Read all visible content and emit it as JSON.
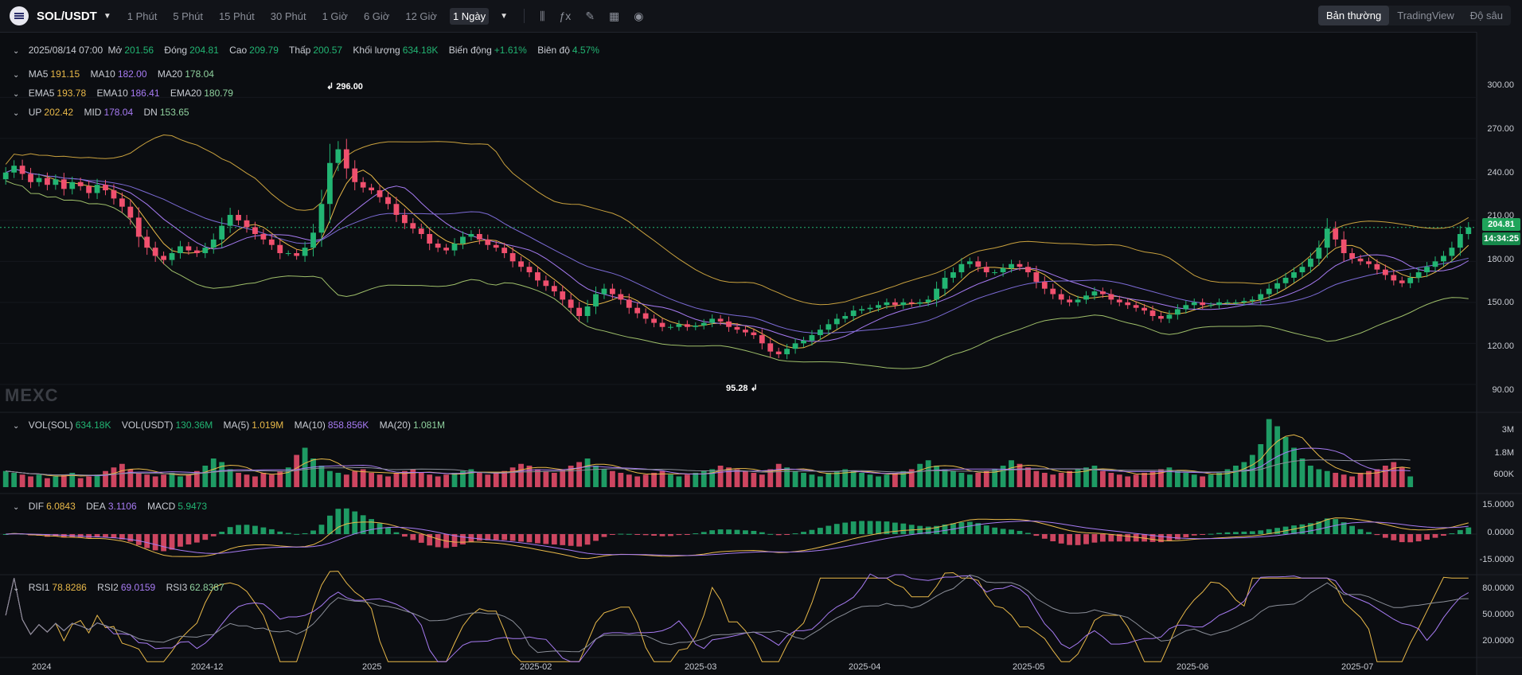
{
  "topbar": {
    "symbol": "SOL/USDT",
    "timeframes": [
      "1 Phút",
      "5 Phút",
      "15 Phút",
      "30 Phút",
      "1 Giờ",
      "6 Giờ",
      "12 Giờ",
      "1 Ngày"
    ],
    "active_timeframe": "1 Ngày",
    "views": [
      "Bản thường",
      "TradingView",
      "Độ sâu"
    ],
    "active_view": "Bản thường",
    "tools": [
      "candles-icon",
      "indicator-icon",
      "draw-icon",
      "layout-icon",
      "camera-icon"
    ]
  },
  "ohlc": {
    "date": "2025/08/14 07:00",
    "open_label": "Mở",
    "open": "201.56",
    "close_label": "Đóng",
    "close": "204.81",
    "high_label": "Cao",
    "high": "209.79",
    "low_label": "Thấp",
    "low": "200.57",
    "vol_label": "Khối lượng",
    "vol": "634.18K",
    "change_label": "Biến động",
    "change": "+1.61%",
    "amp_label": "Biên độ",
    "amp": "4.57%"
  },
  "ma": {
    "ma5_label": "MA5",
    "ma5": "191.15",
    "ma10_label": "MA10",
    "ma10": "182.00",
    "ma20_label": "MA20",
    "ma20": "178.04"
  },
  "ema": {
    "ema5_label": "EMA5",
    "ema5": "193.78",
    "ema10_label": "EMA10",
    "ema10": "186.41",
    "ema20_label": "EMA20",
    "ema20": "180.79"
  },
  "boll": {
    "up_label": "UP",
    "up": "202.42",
    "mid_label": "MID",
    "mid": "178.04",
    "dn_label": "DN",
    "dn": "153.65"
  },
  "volume": {
    "sol_label": "VOL(SOL)",
    "sol": "634.18K",
    "usdt_label": "VOL(USDT)",
    "usdt": "130.36M",
    "ma5_label": "MA(5)",
    "ma5": "1.019M",
    "ma10_label": "MA(10)",
    "ma10": "858.856K",
    "ma20_label": "MA(20)",
    "ma20": "1.081M"
  },
  "macd": {
    "dif_label": "DIF",
    "dif": "6.0843",
    "dea_label": "DEA",
    "dea": "3.1106",
    "macd_label": "MACD",
    "macd": "5.9473"
  },
  "rsi": {
    "rsi1_label": "RSI1",
    "rsi1": "78.8286",
    "rsi2_label": "RSI2",
    "rsi2": "69.0159",
    "rsi3_label": "RSI3",
    "rsi3": "62.8387"
  },
  "watermark": "MEXC",
  "colors": {
    "up": "#22b573",
    "down": "#f0506e",
    "ma5": "#e9b949",
    "ma10": "#a77bf3",
    "ma20": "#8fd19e",
    "background": "#0b0d11"
  },
  "chart_data": {
    "type": "candlestick",
    "last_price": "204.81",
    "countdown": "14:34:25",
    "max_label": "296.00",
    "min_label": "95.28",
    "price_axis": [
      "300.00",
      "270.00",
      "240.00",
      "210.00",
      "180.00",
      "150.00",
      "120.00",
      "90.00"
    ],
    "volume_axis": [
      "3M",
      "1.8M",
      "600K"
    ],
    "macd_axis": [
      "15.0000",
      "0.0000",
      "-15.0000"
    ],
    "rsi_axis": [
      "80.0000",
      "50.0000",
      "20.0000"
    ],
    "x_labels": [
      "2024",
      "2024-12",
      "2025",
      "2025-02",
      "2025-03",
      "2025-04",
      "2025-05",
      "2025-06",
      "2025-07"
    ],
    "price_range": [
      80,
      320
    ],
    "closes": [
      245,
      250,
      244,
      238,
      241,
      236,
      240,
      233,
      238,
      235,
      230,
      236,
      232,
      226,
      220,
      212,
      198,
      190,
      184,
      181,
      186,
      191,
      188,
      186,
      190,
      196,
      206,
      214,
      210,
      205,
      200,
      196,
      192,
      186,
      186,
      184,
      190,
      201,
      222,
      252,
      262,
      248,
      238,
      234,
      232,
      227,
      222,
      214,
      208,
      204,
      200,
      193,
      190,
      188,
      193,
      198,
      200,
      196,
      192,
      190,
      186,
      180,
      176,
      172,
      166,
      162,
      158,
      152,
      146,
      140,
      147,
      156,
      160,
      156,
      152,
      146,
      142,
      138,
      135,
      132,
      132,
      134,
      132,
      133,
      135,
      138,
      136,
      132,
      130,
      128,
      126,
      120,
      114,
      112,
      116,
      120,
      122,
      126,
      130,
      134,
      138,
      140,
      144,
      145,
      146,
      148,
      150,
      148,
      150,
      149,
      150,
      152,
      160,
      168,
      172,
      178,
      180,
      176,
      172,
      172,
      175,
      178,
      176,
      172,
      165,
      160,
      156,
      152,
      150,
      152,
      155,
      158,
      156,
      152,
      150,
      148,
      146,
      144,
      140,
      138,
      141,
      145,
      148,
      150,
      148,
      148,
      150,
      150,
      150,
      151,
      152,
      156,
      160,
      164,
      168,
      172,
      176,
      182,
      190,
      204,
      196,
      186,
      182,
      180,
      178,
      174,
      170,
      166,
      164,
      168,
      172,
      176,
      180,
      184,
      190,
      200,
      204.81
    ],
    "volumes": [
      0.9,
      0.8,
      0.7,
      0.6,
      0.7,
      0.5,
      0.6,
      0.7,
      0.8,
      0.5,
      0.6,
      0.7,
      0.9,
      1.1,
      1.3,
      1.0,
      0.8,
      0.7,
      0.6,
      0.7,
      0.8,
      0.6,
      0.7,
      0.9,
      1.2,
      1.6,
      1.4,
      1.0,
      0.8,
      0.7,
      0.6,
      0.8,
      0.7,
      0.9,
      1.1,
      1.8,
      2.2,
      1.6,
      1.2,
      0.9,
      0.8,
      0.7,
      0.9,
      1.0,
      0.8,
      0.7,
      0.6,
      0.8,
      0.9,
      1.0,
      0.8,
      0.7,
      0.6,
      0.7,
      0.8,
      0.9,
      1.0,
      0.8,
      0.7,
      0.8,
      0.9,
      1.1,
      1.3,
      1.2,
      1.0,
      0.9,
      0.8,
      1.0,
      1.2,
      1.4,
      1.6,
      1.2,
      1.0,
      0.9,
      0.8,
      0.7,
      0.6,
      0.7,
      0.8,
      0.9,
      0.7,
      0.6,
      0.7,
      0.8,
      0.9,
      1.0,
      1.2,
      1.1,
      1.0,
      0.9,
      0.8,
      0.7,
      1.0,
      1.3,
      1.1,
      0.9,
      0.8,
      0.7,
      0.6,
      0.8,
      0.9,
      1.0,
      0.9,
      0.8,
      0.7,
      0.6,
      0.7,
      0.8,
      0.9,
      1.0,
      1.3,
      1.5,
      1.2,
      1.0,
      0.9,
      0.8,
      0.7,
      0.8,
      0.9,
      1.0,
      1.2,
      1.5,
      1.3,
      1.1,
      0.9,
      0.8,
      0.7,
      0.8,
      0.9,
      1.0,
      1.1,
      1.2,
      0.9,
      0.8,
      0.7,
      0.6,
      0.7,
      0.8,
      0.9,
      1.0,
      1.1,
      0.9,
      0.8,
      0.7,
      0.6,
      0.7,
      0.8,
      1.0,
      1.2,
      1.4,
      1.8,
      2.4,
      3.8,
      3.4,
      2.8,
      2.2,
      1.6,
      1.2,
      1.0,
      0.9,
      0.8,
      0.7,
      0.6,
      0.8,
      0.9,
      1.0,
      1.2,
      1.4,
      1.1,
      0.6
    ]
  }
}
